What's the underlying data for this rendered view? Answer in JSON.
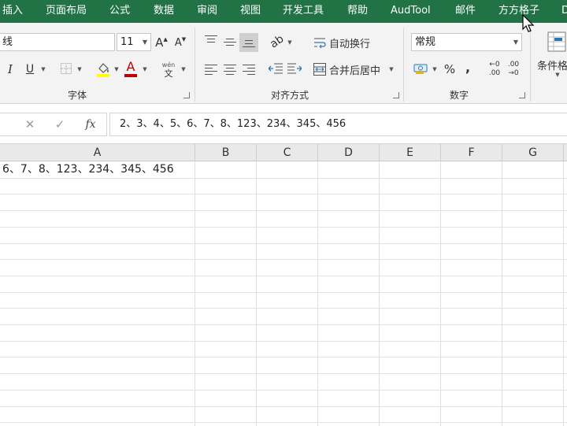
{
  "menu": {
    "tabs": [
      "插入",
      "页面布局",
      "公式",
      "数据",
      "审阅",
      "视图",
      "开发工具",
      "帮助",
      "AudTool",
      "邮件",
      "方方格子",
      "D"
    ]
  },
  "ribbon": {
    "font_group": {
      "font_name": "线",
      "font_size": "11",
      "grow_label": "A",
      "shrink_label": "A",
      "italic_label": "I",
      "underline_label": "U",
      "font_color_label": "A",
      "phonetic_top": "wén",
      "phonetic_bottom": "文",
      "label": "字体",
      "font_color": "#c00000",
      "fill_color": "#ffff00"
    },
    "align_group": {
      "wrap_text": "自动换行",
      "merge_center": "合并后居中",
      "label": "对齐方式"
    },
    "number_group": {
      "format": "常规",
      "percent": "%",
      "comma": ",",
      "inc_decimal_top": "←0",
      "inc_decimal_bottom": ".00",
      "dec_decimal_top": ".00",
      "dec_decimal_bottom": "→0",
      "label": "数字"
    },
    "styles_group": {
      "cond_format": "条件格"
    }
  },
  "formula_bar": {
    "cancel": "✕",
    "confirm": "✓",
    "fx": "fx",
    "content": "2、3、4、5、6、7、8、123、234、345、456"
  },
  "grid": {
    "columns": [
      "A",
      "B",
      "C",
      "D",
      "E",
      "F",
      "G"
    ],
    "cell_a1": "6、7、8、123、234、345、456"
  },
  "colors": {
    "accent": "#217346"
  }
}
